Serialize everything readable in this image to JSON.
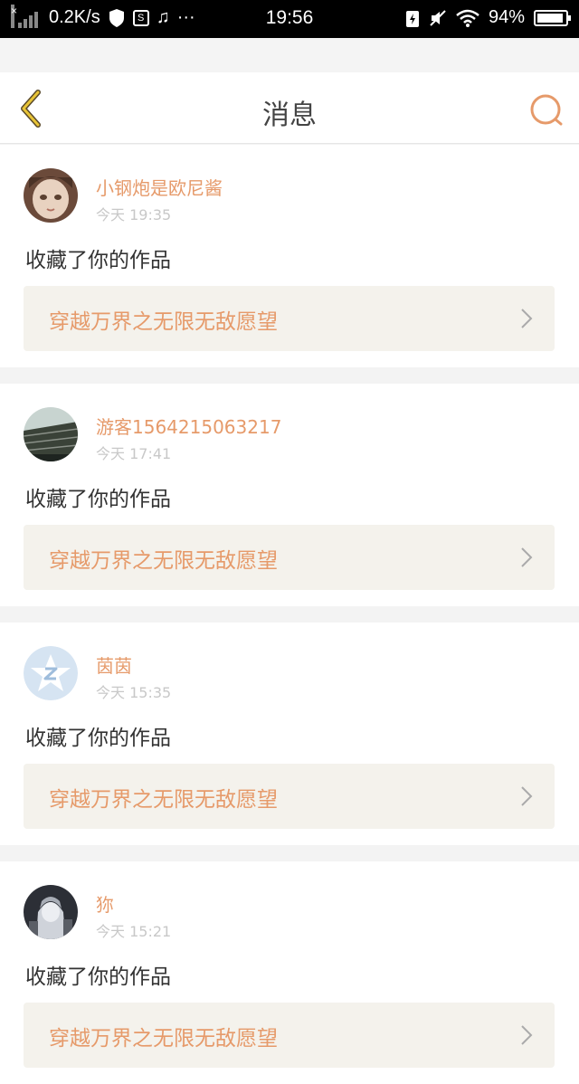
{
  "status_bar": {
    "speed": "0.2K/s",
    "time": "19:56",
    "battery": "94%",
    "icons": [
      "signal-icon",
      "shield-icon",
      "screenshot-icon",
      "music-icon",
      "more-icon",
      "charging-icon",
      "mute-icon",
      "wifi-icon",
      "battery-icon"
    ]
  },
  "header": {
    "title": "消息",
    "back_icon": "chevron-left-icon",
    "search_icon": "search-icon"
  },
  "colors": {
    "accent": "#e69a6a",
    "back_arrow": "#e8c436",
    "card_bg": "#f4f2ec"
  },
  "messages": [
    {
      "user": "小钢炮是欧尼酱",
      "time": "今天 19:35",
      "action": "收藏了你的作品",
      "work": "穿越万界之无限无敌愿望",
      "avatar": "doll-avatar"
    },
    {
      "user": "游客1564215063217",
      "time": "今天 17:41",
      "action": "收藏了你的作品",
      "work": "穿越万界之无限无敌愿望",
      "avatar": "building-avatar"
    },
    {
      "user": "茵茵",
      "time": "今天 15:35",
      "action": "收藏了你的作品",
      "work": "穿越万界之无限无敌愿望",
      "avatar": "default-avatar"
    },
    {
      "user": "狝",
      "time": "今天 15:21",
      "action": "收藏了你的作品",
      "work": "穿越万界之无限无敌愿望",
      "avatar": "anime-avatar"
    }
  ]
}
